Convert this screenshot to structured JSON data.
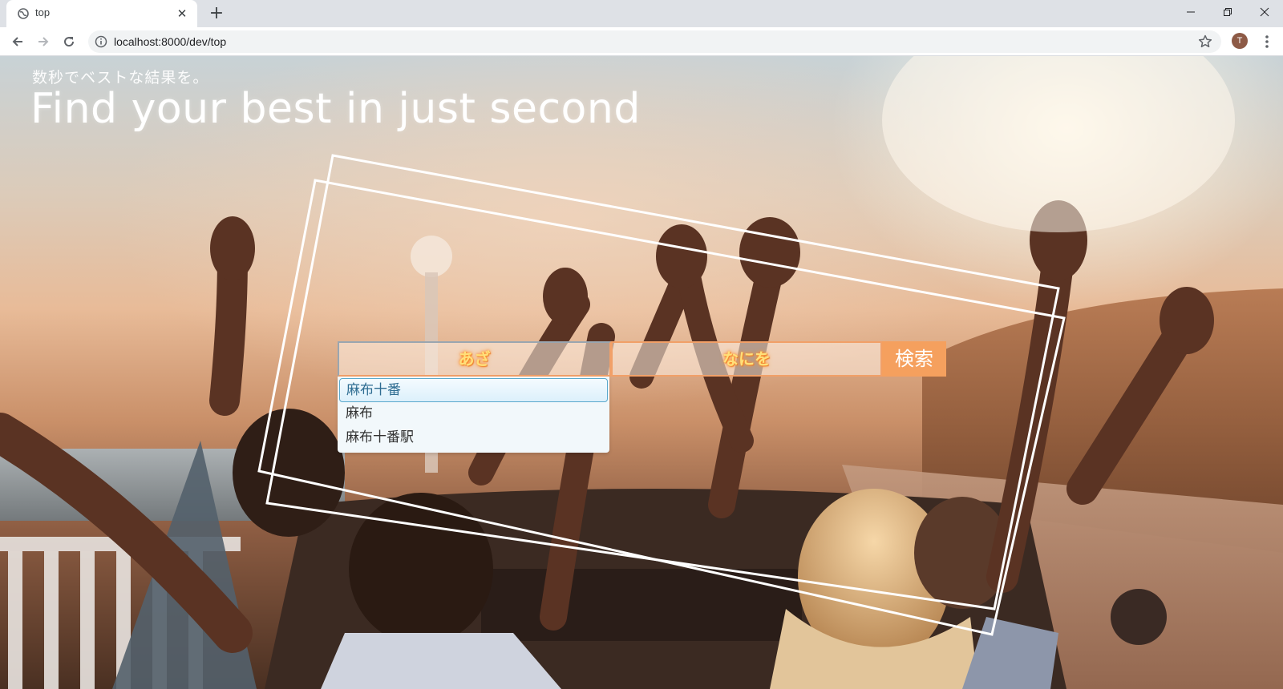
{
  "browser": {
    "tab_title": "top",
    "tab_close": "✕",
    "new_tab": "+",
    "url": "localhost:8000/dev/top",
    "profile_initial": "T"
  },
  "hero": {
    "tagline_jp": "数秒でベストな結果を。",
    "headline": "Find your best in just second"
  },
  "search": {
    "where_label": "あざ",
    "what_label": "なにを",
    "button_label": "検索"
  },
  "suggestions": [
    {
      "label": "麻布十番",
      "highlighted": true
    },
    {
      "label": "麻布",
      "highlighted": false
    },
    {
      "label": "麻布十番駅",
      "highlighted": false
    }
  ],
  "colors": {
    "accent": "#f5a05e",
    "field_border": "#f1a068",
    "highlight_border": "#5aa8cc"
  }
}
